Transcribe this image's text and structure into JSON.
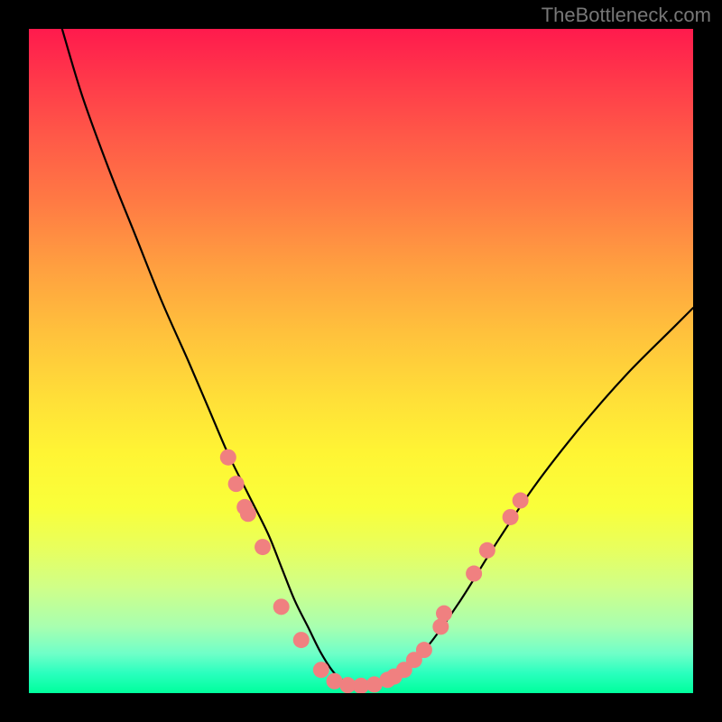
{
  "watermark": "TheBottleneck.com",
  "colors": {
    "frame": "#000000",
    "curve": "#000000",
    "dot_fill": "#f08080",
    "dot_stroke": "#d46a6a"
  },
  "chart_data": {
    "type": "line",
    "title": "",
    "xlabel": "",
    "ylabel": "",
    "xlim": [
      0,
      100
    ],
    "ylim": [
      0,
      100
    ],
    "series": [
      {
        "name": "curve",
        "x": [
          5,
          8,
          12,
          16,
          20,
          24,
          27,
          30,
          33,
          36,
          38,
          40,
          42,
          44,
          46,
          48,
          50,
          53,
          56,
          60,
          65,
          70,
          76,
          83,
          90,
          97,
          100
        ],
        "y": [
          100,
          90,
          79,
          69,
          59,
          50,
          43,
          36,
          30,
          24,
          19,
          14,
          10,
          6,
          3,
          1.5,
          1,
          1.5,
          3,
          7,
          14,
          22,
          31,
          40,
          48,
          55,
          58
        ]
      }
    ],
    "scatter": [
      {
        "name": "dots",
        "points": [
          [
            30.0,
            35.5
          ],
          [
            31.2,
            31.5
          ],
          [
            32.5,
            28.0
          ],
          [
            33.0,
            27.0
          ],
          [
            35.2,
            22.0
          ],
          [
            38.0,
            13.0
          ],
          [
            41.0,
            8.0
          ],
          [
            44.0,
            3.5
          ],
          [
            46.0,
            1.8
          ],
          [
            48.0,
            1.2
          ],
          [
            50.0,
            1.1
          ],
          [
            52.0,
            1.3
          ],
          [
            54.0,
            2.0
          ],
          [
            55.0,
            2.5
          ],
          [
            56.5,
            3.5
          ],
          [
            58.0,
            5.0
          ],
          [
            59.5,
            6.5
          ],
          [
            62.0,
            10.0
          ],
          [
            62.5,
            12.0
          ],
          [
            67.0,
            18.0
          ],
          [
            69.0,
            21.5
          ],
          [
            72.5,
            26.5
          ],
          [
            74.0,
            29.0
          ]
        ]
      }
    ]
  }
}
